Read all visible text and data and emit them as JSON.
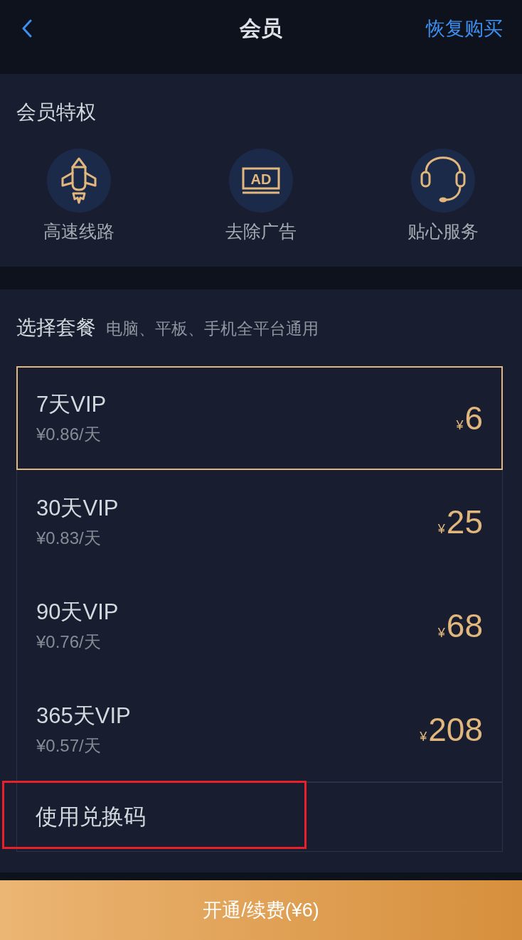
{
  "header": {
    "title": "会员",
    "action": "恢复购买"
  },
  "privileges": {
    "title": "会员特权",
    "items": [
      {
        "kind": "rocket",
        "label": "高速线路"
      },
      {
        "kind": "ad",
        "icon_text": "AD",
        "label": "去除广告"
      },
      {
        "kind": "headset",
        "label": "贴心服务"
      }
    ]
  },
  "plans": {
    "title": "选择套餐",
    "subtitle": "电脑、平板、手机全平台通用",
    "items": [
      {
        "name": "7天VIP",
        "per_day": "¥0.86/天",
        "currency": "¥",
        "price": "6",
        "selected": true
      },
      {
        "name": "30天VIP",
        "per_day": "¥0.83/天",
        "currency": "¥",
        "price": "25",
        "selected": false
      },
      {
        "name": "90天VIP",
        "per_day": "¥0.76/天",
        "currency": "¥",
        "price": "68",
        "selected": false
      },
      {
        "name": "365天VIP",
        "per_day": "¥0.57/天",
        "currency": "¥",
        "price": "208",
        "selected": false
      }
    ]
  },
  "redeem": {
    "label": "使用兑换码",
    "highlighted": true
  },
  "purchase_button": {
    "label": "开通/续费(¥6)"
  }
}
